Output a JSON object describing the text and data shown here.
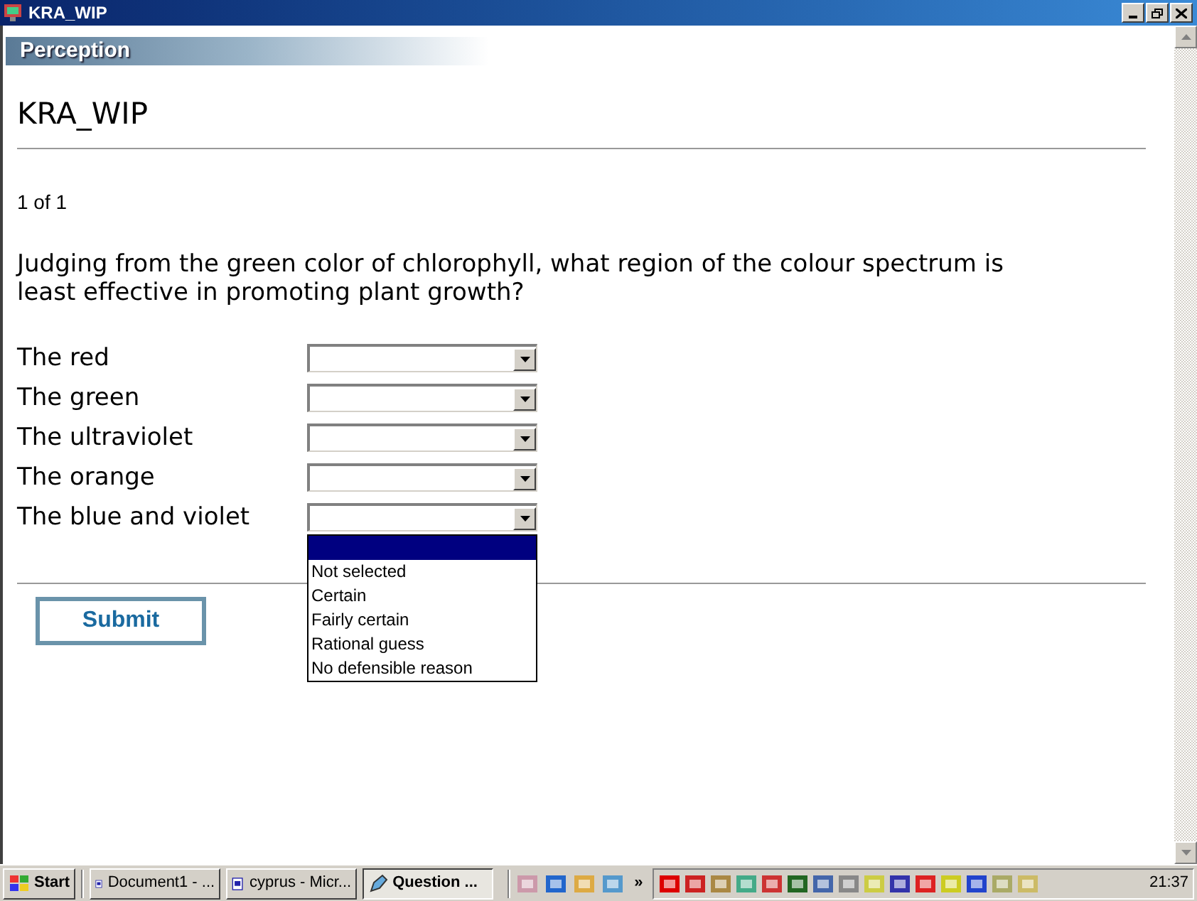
{
  "window": {
    "title": "KRA_WIP"
  },
  "banner": {
    "title": "Perception"
  },
  "heading": "KRA_WIP",
  "counter": "1 of 1",
  "question": "Judging from the green color of chlorophyll, what region of the colour spectrum is least effective in promoting plant growth?",
  "answers": [
    {
      "label": "The red"
    },
    {
      "label": "The green"
    },
    {
      "label": "The ultraviolet"
    },
    {
      "label": "The orange"
    },
    {
      "label": "The blue and violet",
      "options": [
        {
          "selected": true
        },
        {
          "label": "Not selected",
          "selected": false
        },
        {
          "label": "Certain",
          "selected": false
        },
        {
          "label": "Fairly certain",
          "selected": false
        },
        {
          "label": "Rational guess",
          "selected": false
        },
        {
          "label": "No defensible reason",
          "selected": false
        }
      ]
    }
  ],
  "submit": "Submit",
  "taskbar": {
    "start": "Start",
    "tasks": [
      {
        "label": "Document1 - ...",
        "selected": false,
        "kind": "word"
      },
      {
        "label": "cyprus - Micr...",
        "selected": false,
        "kind": "word"
      },
      {
        "label": "Question ...",
        "selected": true,
        "kind": "app"
      }
    ],
    "overflow": "»",
    "clock": "21:37"
  }
}
